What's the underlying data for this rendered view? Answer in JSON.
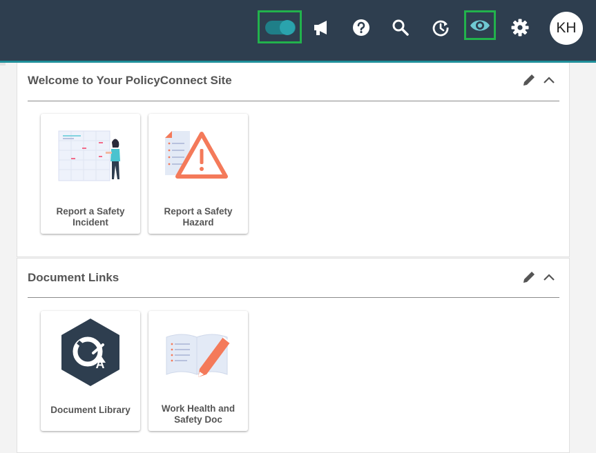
{
  "topbar": {
    "background": "#2e3e4f",
    "accent": "#1f8f9a",
    "highlight_color": "#22b24c",
    "icons": [
      "toggle-switch-icon",
      "megaphone-icon",
      "help-icon",
      "search-icon",
      "history-icon",
      "eye-icon",
      "gear-icon"
    ],
    "avatar_initials": "KH"
  },
  "panels": [
    {
      "title": "Welcome to Your PolicyConnect Site",
      "tiles": [
        {
          "label": "Report a Safety Incident",
          "icon": "safety-incident-illustration"
        },
        {
          "label": "Report a Safety Hazard",
          "icon": "warning-triangle-illustration"
        }
      ]
    },
    {
      "title": "Document Links",
      "tiles": [
        {
          "label": "Document Library",
          "icon": "document-library-logo"
        },
        {
          "label": "Work Health and Safety Doc",
          "icon": "open-book-pencil-illustration"
        }
      ]
    }
  ]
}
